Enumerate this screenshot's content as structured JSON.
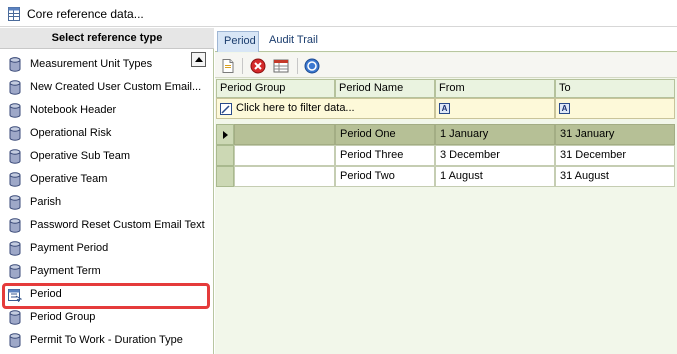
{
  "window": {
    "title": "Core reference data...",
    "icon": "table-icon"
  },
  "left_panel": {
    "header": "Select reference type",
    "items": [
      {
        "label": "Measurement Unit Types",
        "icon": "database-icon"
      },
      {
        "label": "New Created User Custom Email...",
        "icon": "database-icon"
      },
      {
        "label": "Notebook Header",
        "icon": "database-icon"
      },
      {
        "label": "Operational Risk",
        "icon": "database-icon"
      },
      {
        "label": "Operative Sub Team",
        "icon": "database-icon"
      },
      {
        "label": "Operative Team",
        "icon": "database-icon"
      },
      {
        "label": "Parish",
        "icon": "database-icon"
      },
      {
        "label": "Password Reset Custom Email Text",
        "icon": "database-icon"
      },
      {
        "label": "Payment Period",
        "icon": "database-icon"
      },
      {
        "label": "Payment Term",
        "icon": "database-icon"
      },
      {
        "label": "Period",
        "icon": "calendar-icon",
        "selected": true
      },
      {
        "label": "Period Group",
        "icon": "database-icon"
      },
      {
        "label": "Permit To Work - Duration Type",
        "icon": "database-icon"
      }
    ],
    "highlight_color": "#e53b3b"
  },
  "tabs": [
    {
      "label": "Period",
      "active": true
    },
    {
      "label": "Audit Trail",
      "active": false
    }
  ],
  "toolbar": {
    "buttons": [
      {
        "name": "new-icon"
      },
      {
        "name": "delete-icon"
      },
      {
        "name": "grid-options-icon"
      },
      {
        "name": "help-icon"
      }
    ]
  },
  "grid": {
    "columns": [
      "Period Group",
      "Period Name",
      "From",
      "To"
    ],
    "filter_placeholder": "Click here to filter data...",
    "filter_icon_glyph": "A",
    "rows": [
      {
        "period_group": "",
        "period_name": "Period One",
        "from": "1 January",
        "to": "31 January",
        "active": true
      },
      {
        "period_group": "",
        "period_name": "Period Three",
        "from": "3 December",
        "to": "31 December",
        "active": false
      },
      {
        "period_group": "",
        "period_name": "Period Two",
        "from": "1 August",
        "to": "31 August",
        "active": false
      }
    ]
  }
}
